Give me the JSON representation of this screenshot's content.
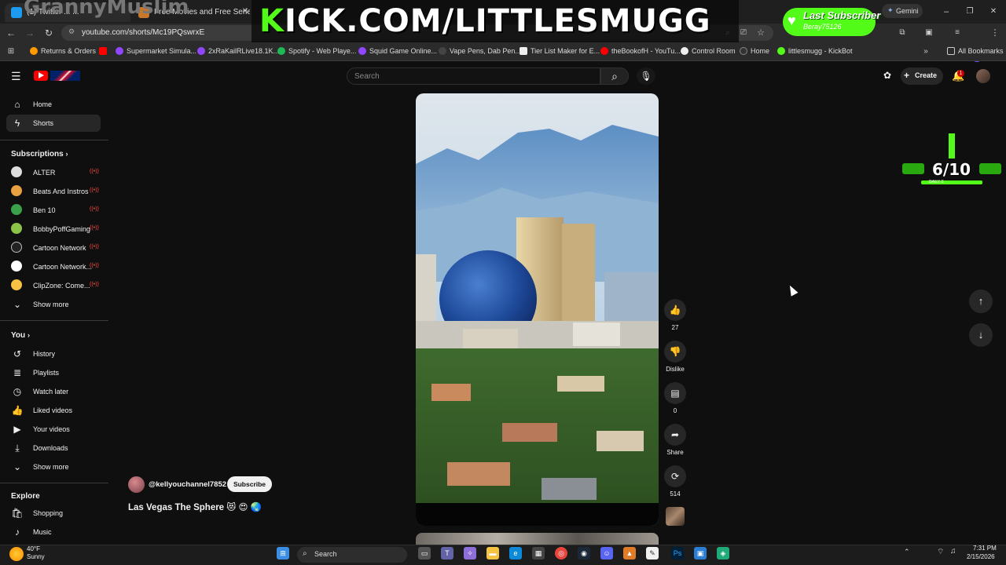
{
  "overlay": {
    "streamer_name": "GrannyMuslim",
    "banner_prefix": "K",
    "banner_rest": "ICK.COM/LITTLESMUGG",
    "last_subscriber_title": "Last Subscriber",
    "last_subscriber_name": "Beray75126",
    "daily_count": "6/10",
    "daily_label": "DAILY S",
    "brand_green": "#53fc18"
  },
  "browser": {
    "tabs": [
      {
        "label": "(1) Twitter ... ...",
        "icon": "twitter-icon"
      },
      {
        "label": "Free Movies and Free Series On...",
        "icon": "movie-icon"
      }
    ],
    "url": "youtube.com/shorts/Mc19PQswrxE",
    "gemini_label": "Gemini",
    "bookmarks": [
      {
        "label": "Returns & Orders",
        "color": "#ff9900"
      },
      {
        "label": "",
        "color": "#ff0000"
      },
      {
        "label": "Supermarket Simula...",
        "color": "#9146ff"
      },
      {
        "label": "2xRaKailRLive18.1K...",
        "color": "#9146ff"
      },
      {
        "label": "Spotify - Web Playe...",
        "color": "#1db954"
      },
      {
        "label": "Squid Game Online...",
        "color": "#9146ff"
      },
      {
        "label": "Vape Pens, Dab Pen...",
        "color": "#444444"
      },
      {
        "label": "Tier List Maker for E...",
        "color": "#eeeeee"
      },
      {
        "label": "theBookofH - YouTu...",
        "color": "#ff0000"
      },
      {
        "label": "Control Room",
        "color": "#eeeeee"
      },
      {
        "label": "Home",
        "color": "#333333"
      },
      {
        "label": "littlesmugg - KickBot",
        "color": "#53fc18"
      }
    ],
    "all_bookmarks": "All Bookmarks"
  },
  "youtube": {
    "search_placeholder": "Search",
    "create_label": "Create",
    "notification_count": "1",
    "accent": "#ff0000"
  },
  "sidebar": {
    "main": [
      {
        "label": "Home",
        "icon": "home-icon"
      },
      {
        "label": "Shorts",
        "icon": "shorts-icon"
      }
    ],
    "subscriptions_head": "Subscriptions",
    "subscriptions": [
      {
        "label": "ALTER",
        "color": "#dddddd"
      },
      {
        "label": "Beats And Instros",
        "color": "#e8a040"
      },
      {
        "label": "Ben 10",
        "color": "#3aa04a"
      },
      {
        "label": "BobbyPoffGaming",
        "color": "#8bc34a"
      },
      {
        "label": "Cartoon Network",
        "color": "#222222"
      },
      {
        "label": "Cartoon Network...",
        "color": "#ffffff"
      },
      {
        "label": "ClipZone: Come...",
        "color": "#f5c242"
      }
    ],
    "show_more": "Show more",
    "you_head": "You",
    "you_items": [
      {
        "label": "History",
        "icon": "history-icon"
      },
      {
        "label": "Playlists",
        "icon": "playlists-icon"
      },
      {
        "label": "Watch later",
        "icon": "clock-icon"
      },
      {
        "label": "Liked videos",
        "icon": "thumbs-up-icon"
      },
      {
        "label": "Your videos",
        "icon": "video-icon"
      },
      {
        "label": "Downloads",
        "icon": "download-icon"
      }
    ],
    "show_more_2": "Show more",
    "explore_head": "Explore",
    "explore_items": [
      {
        "label": "Shopping",
        "icon": "shopping-icon"
      },
      {
        "label": "Music",
        "icon": "music-icon"
      }
    ]
  },
  "short": {
    "channel": "@kellyouchannel7852",
    "subscribe_label": "Subscribe",
    "title": "Las Vegas The Sphere 😻 😍 🌏",
    "likes": "27",
    "dislike_label": "Dislike",
    "comments": "0",
    "share_label": "Share",
    "remix_count": "514"
  },
  "taskbar": {
    "weather_temp": "40°F",
    "weather_desc": "Sunny",
    "search_label": "Search",
    "time": "7:31 PM",
    "date": "2/15/2026"
  }
}
